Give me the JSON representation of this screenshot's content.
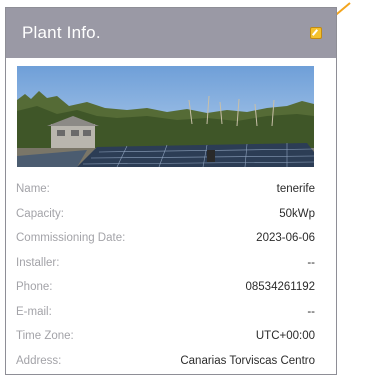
{
  "panel": {
    "title": "Plant Info.",
    "accent_color": "#f4c12d",
    "header_color": "#9a99a5",
    "edit_icon": "edit-icon",
    "annotation_icon": "arrow-icon"
  },
  "photo": {
    "description_icon": "plant-photo"
  },
  "fields": [
    {
      "label": "Name:",
      "value": "tenerife"
    },
    {
      "label": "Capacity:",
      "value": "50kWp"
    },
    {
      "label": "Commissioning Date:",
      "value": "2023-06-06"
    },
    {
      "label": "Installer:",
      "value": "--"
    },
    {
      "label": "Phone:",
      "value": "08534261192"
    },
    {
      "label": "E-mail:",
      "value": "--"
    },
    {
      "label": "Time Zone:",
      "value": "UTC+00:00"
    },
    {
      "label": "Address:",
      "value": "Canarias Torviscas Centro"
    }
  ]
}
